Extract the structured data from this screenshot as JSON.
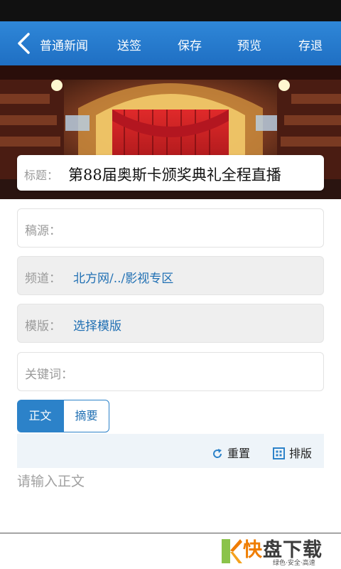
{
  "header": {
    "title": "普通新闻",
    "actions": {
      "send": "送签",
      "save": "保存",
      "preview": "预览",
      "exit": "存退"
    }
  },
  "article": {
    "title_label": "标题：",
    "title_value": "第88届奥斯卡颁奖典礼全程直播"
  },
  "fields": {
    "source_label": "稿源：",
    "channel_label": "频道：",
    "channel_value": "北方网/../影视专区",
    "template_label": "模版：",
    "template_value": "选择模版",
    "keywords_label": "关键词："
  },
  "tabs": {
    "body": "正文",
    "summary": "摘要"
  },
  "toolbar": {
    "reset": "重置",
    "layout": "排版"
  },
  "editor": {
    "placeholder": "请输入正文"
  },
  "watermark": {
    "brand_a": "快",
    "brand_b": "盘下载",
    "slogan": "绿色·安全·高速"
  },
  "colors": {
    "header": "#2f87d8",
    "accent": "#2c82c9",
    "link": "#1f6fb3",
    "logo_orange": "#ef7d00"
  }
}
